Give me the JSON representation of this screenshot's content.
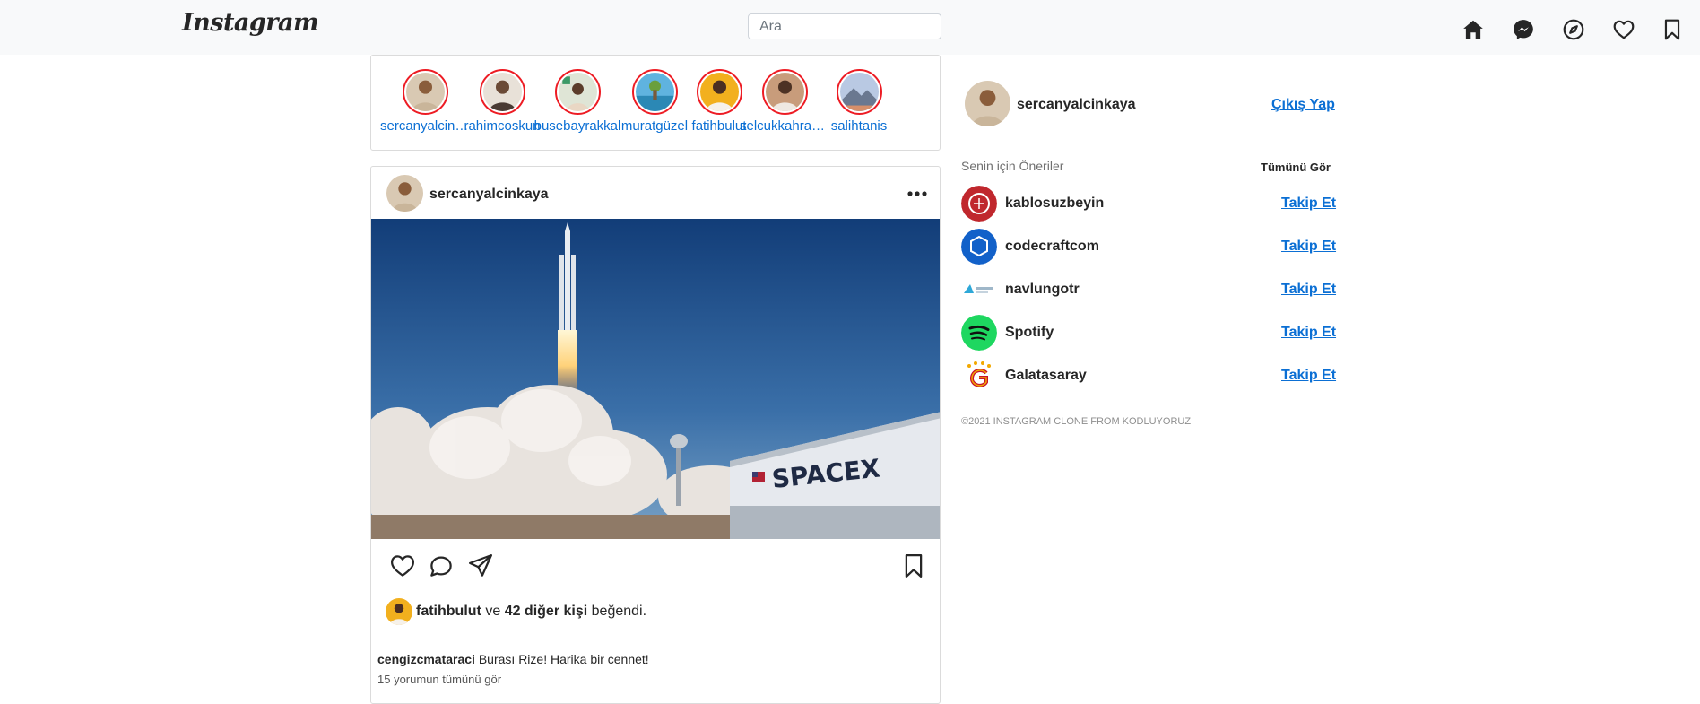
{
  "header": {
    "logo_text": "Instagram",
    "search_placeholder": "Ara",
    "icons": [
      "home-icon",
      "messenger-icon",
      "explore-icon",
      "heart-icon",
      "bookmark-icon"
    ]
  },
  "stories": [
    {
      "name": "sercanyalcinkaya",
      "avatar_color": "#c9b59a"
    },
    {
      "name": "rahimcoskun",
      "avatar_color": "#8a7461"
    },
    {
      "name": "busebayrakkal",
      "avatar_color": "#7e9a6b"
    },
    {
      "name": "muratgüzel",
      "avatar_color": "#4f9bc3"
    },
    {
      "name": "fatihbulut",
      "avatar_color": "#e8a52a"
    },
    {
      "name": "selcukkahraman",
      "avatar_color": "#a97a5c"
    },
    {
      "name": "salihtanis",
      "avatar_color": "#9fb4d1"
    }
  ],
  "post": {
    "username": "sercanyalcinkaya",
    "image_text": "SPACEX",
    "liked_by": "fatihbulut",
    "likes_connector": "ve",
    "others": "42 diğer kişi",
    "likes_suffix": "beğendi.",
    "comment_user": "cengizcmataraci",
    "comment_text": "Burası Rize! Harika bir cennet!",
    "view_comments": "15 yorumun tümünü gör"
  },
  "sidebar": {
    "username": "sercanyalcinkaya",
    "logout_label": "Çıkış Yap",
    "suggestions_title": "Senin için Öneriler",
    "see_all_label": "Tümünü Gör",
    "follow_label": "Takip Et",
    "suggestions": [
      {
        "name": "kablosuzbeyin",
        "color": "#c0272d"
      },
      {
        "name": "codecraftcom",
        "color": "#1261c9"
      },
      {
        "name": "navlungotr",
        "color": "#2ea8d8"
      },
      {
        "name": "Spotify",
        "color": "#1ed760"
      },
      {
        "name": "Galatasaray",
        "color": "#f2a800"
      }
    ],
    "footer": "©2021 INSTAGRAM CLONE FROM KODLUYORUZ"
  }
}
